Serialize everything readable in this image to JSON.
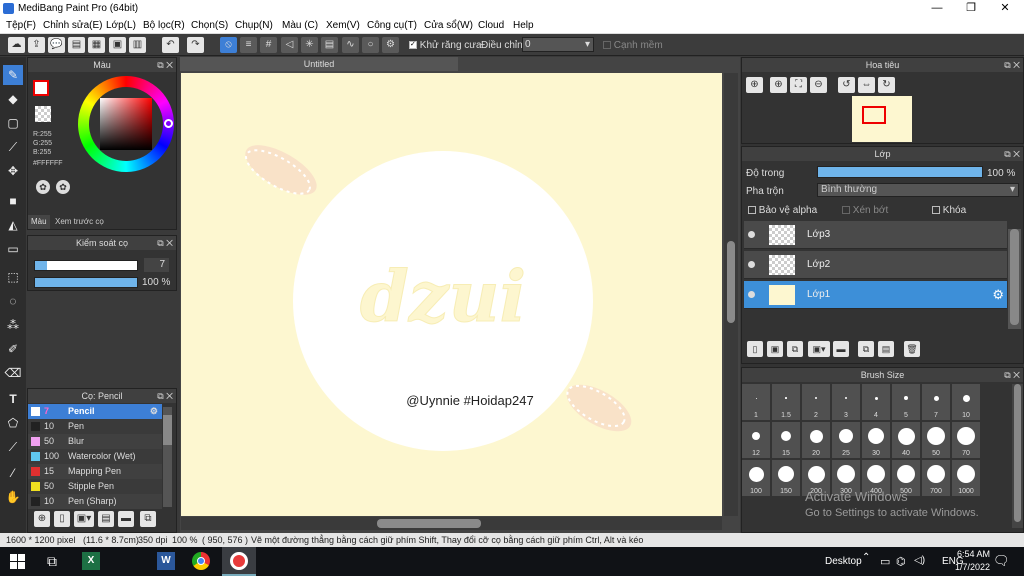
{
  "window": {
    "title": "MediBang Paint Pro (64bit)",
    "min": "—",
    "max": "❐",
    "close": "✕"
  },
  "menu": [
    "Tệp(F)",
    "Chỉnh sửa(E)",
    "Lớp(L)",
    "Bộ lọc(R)",
    "Chọn(S)",
    "Chụp(N)",
    "Màu (C)",
    "Xem(V)",
    "Công cụ(T)",
    "Cửa sổ(W)",
    "Cloud",
    "Help"
  ],
  "toolbar": {
    "antialias_label": "Khử răng cưa",
    "adjust_label": "Điều chỉnh",
    "adjust_value": "0",
    "margin_label": "Cạnh mềm"
  },
  "color_panel": {
    "title": "Màu",
    "r": "R:255",
    "g": "G:255",
    "b": "B:255",
    "hex": "#FFFFFF",
    "tab_color": "Màu",
    "tab_preview": "Xem trước cọ"
  },
  "brush_control": {
    "title": "Kiểm soát cọ",
    "size": "7",
    "opacity": "100 %",
    "opacity_level": 1.0
  },
  "brush_list": {
    "title": "Cọ: Pencil",
    "items": [
      {
        "num": "7",
        "name": "Pencil",
        "color": "#ffffff",
        "selected": true
      },
      {
        "num": "10",
        "name": "Pen",
        "color": "#222222"
      },
      {
        "num": "50",
        "name": "Blur",
        "color": "#f0a0f0"
      },
      {
        "num": "100",
        "name": "Watercolor (Wet)",
        "color": "#60c8f0"
      },
      {
        "num": "15",
        "name": "Mapping Pen",
        "color": "#e03030"
      },
      {
        "num": "50",
        "name": "Stipple Pen",
        "color": "#f0e020"
      },
      {
        "num": "10",
        "name": "Pen (Sharp)",
        "color": "#222222"
      }
    ]
  },
  "canvas": {
    "tab": "Untitled",
    "watermark": "dzui",
    "credit": "@Uynnie #Hoidap247",
    "bg": "#fdf7d0"
  },
  "navigator": {
    "title": "Hoa tiêu"
  },
  "layer_panel": {
    "title": "Lớp",
    "opacity_label": "Độ trong",
    "opacity_value": "100 %",
    "blend_label": "Pha trộn",
    "blend_value": "Bình thường",
    "protect_alpha": "Bảo vệ alpha",
    "clip": "Xén bớt",
    "lock": "Khóa",
    "layers": [
      "Lớp3",
      "Lớp2",
      "Lớp1"
    ],
    "active_layer": "Lớp1"
  },
  "brush_size": {
    "title": "Brush Size",
    "sizes": [
      "1",
      "1.5",
      "2",
      "3",
      "4",
      "5",
      "7",
      "10",
      "12",
      "15",
      "20",
      "25",
      "30",
      "40",
      "50",
      "70",
      "100",
      "150",
      "200",
      "300",
      "400",
      "500",
      "700",
      "1000"
    ]
  },
  "watermark": {
    "line1": "Activate Windows",
    "line2": "Go to Settings to activate Windows."
  },
  "status": {
    "dims": "1600 * 1200 pixel",
    "size": "(11.6 * 8.7cm)",
    "dpi": "350 dpi",
    "zoom": "100 %",
    "coords": "( 950, 576 )",
    "hint": "Vẽ một đường thẳng bằng cách giữ phím Shift, Thay đổi cỡ cọ bằng cách giữ phím Ctrl, Alt và kéo"
  },
  "taskbar": {
    "desktop": "Desktop",
    "lang": "ENG",
    "time": "6:54 AM",
    "date": "1/7/2022"
  }
}
